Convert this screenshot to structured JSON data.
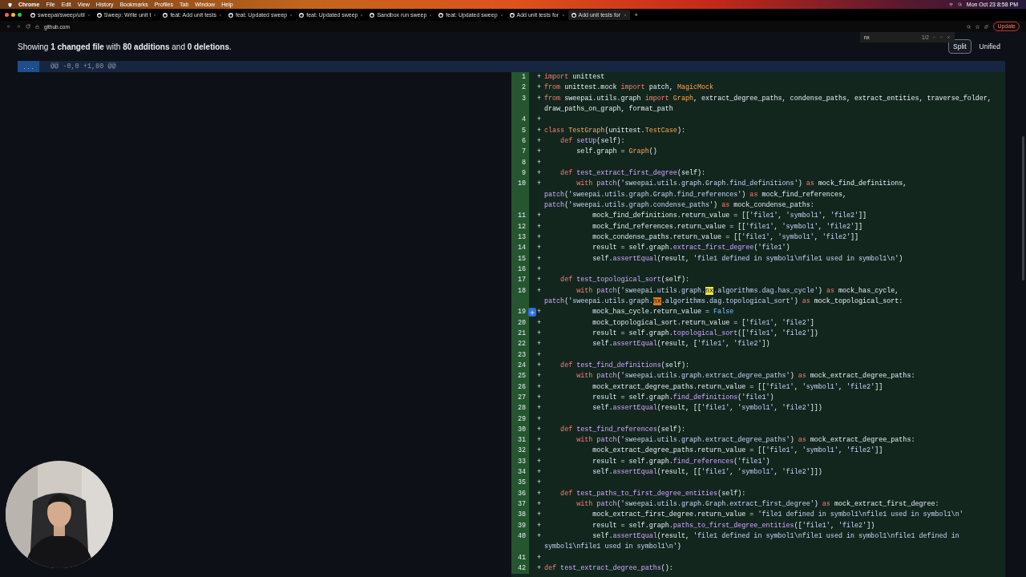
{
  "menu_bar": {
    "items": [
      "Chrome",
      "File",
      "Edit",
      "View",
      "History",
      "Bookmarks",
      "Profiles",
      "Tab",
      "Window",
      "Help"
    ],
    "clock": "Mon Oct 23  8:58 PM"
  },
  "tabs": [
    {
      "label": "sweepai/sweep/util",
      "selected": false
    },
    {
      "label": "Sweep: Write unit t",
      "selected": false
    },
    {
      "label": "feat: Add unit tests",
      "selected": false
    },
    {
      "label": "feat: Updated sweep",
      "selected": false
    },
    {
      "label": "feat: Updated sweep",
      "selected": false
    },
    {
      "label": "Sandbox run sweep",
      "selected": false
    },
    {
      "label": "feat: Updated sweep",
      "selected": false
    },
    {
      "label": "Add unit tests for",
      "selected": false
    },
    {
      "label": "Add unit tests for",
      "selected": true
    }
  ],
  "new_tab": "+",
  "address_bar": {
    "host": "github.com"
  },
  "update_button": "Update",
  "find_bar": {
    "query": "nx",
    "count": "1/2"
  },
  "summary": "Showing **1 changed file** with **80 additions** and **0 deletions**.",
  "view_toggle": [
    {
      "label": "Split",
      "selected": true
    },
    {
      "label": "Unified",
      "selected": false
    }
  ],
  "hunk": {
    "expand": "...",
    "header": "@@ -0,0 +1,80 @@"
  },
  "lines": [
    {
      "number": "1",
      "sign": "+",
      "tokens": [
        {
          "kind": "keyword",
          "text": "import"
        },
        {
          "kind": "plain",
          "text": " unittest"
        }
      ]
    },
    {
      "number": "2",
      "sign": "+",
      "tokens": [
        {
          "kind": "keyword",
          "text": "from"
        },
        {
          "kind": "plain",
          "text": " unittest.mock "
        },
        {
          "kind": "keyword",
          "text": "import"
        },
        {
          "kind": "plain",
          "text": " patch, "
        },
        {
          "kind": "class",
          "text": "MagicMock"
        }
      ]
    },
    {
      "number": "3",
      "sign": "+",
      "tokens": [
        {
          "kind": "keyword",
          "text": "from"
        },
        {
          "kind": "plain",
          "text": " sweepai.utils.graph "
        },
        {
          "kind": "keyword",
          "text": "import "
        },
        {
          "kind": "class",
          "text": "Graph"
        },
        {
          "kind": "plain",
          "text": ", extract_degree_paths, condense_paths, extract_entities, traverse_folder, draw_paths_on_graph, format_path"
        }
      ]
    },
    {
      "number": "4",
      "sign": "+"
    },
    {
      "number": "5",
      "sign": "+",
      "tokens": [
        {
          "kind": "keyword",
          "text": "class "
        },
        {
          "kind": "class",
          "text": "TestGraph"
        },
        {
          "kind": "plain",
          "text": "(unittest."
        },
        {
          "kind": "class",
          "text": "TestCase"
        },
        {
          "kind": "plain",
          "text": "):"
        }
      ]
    },
    {
      "number": "6",
      "sign": "+",
      "tokens": [
        {
          "kind": "keyword",
          "text": "    def "
        },
        {
          "kind": "function",
          "text": "setUp"
        },
        {
          "kind": "plain",
          "text": "(self):"
        }
      ]
    },
    {
      "number": "7",
      "sign": "+",
      "tokens": [
        {
          "kind": "plain",
          "text": "        self.graph = "
        },
        {
          "kind": "class",
          "text": "Graph"
        },
        {
          "kind": "plain",
          "text": "()"
        }
      ]
    },
    {
      "number": "8",
      "sign": "+"
    },
    {
      "number": "9",
      "sign": "+",
      "tokens": [
        {
          "kind": "keyword",
          "text": "    def "
        },
        {
          "kind": "function",
          "text": "test_extract_first_degree"
        },
        {
          "kind": "plain",
          "text": "(self):"
        }
      ]
    },
    {
      "number": "10",
      "sign": "+",
      "tokens": [
        {
          "kind": "keyword",
          "text": "        with "
        },
        {
          "kind": "function",
          "text": "patch"
        },
        {
          "kind": "plain",
          "text": "("
        },
        {
          "kind": "string",
          "text": "'sweepai.utils.graph.Graph.find_definitions'"
        },
        {
          "kind": "plain",
          "text": ") "
        },
        {
          "kind": "keyword",
          "text": "as"
        },
        {
          "kind": "plain",
          "text": " mock_find_definitions, "
        },
        {
          "kind": "function",
          "text": "patch"
        },
        {
          "kind": "plain",
          "text": "("
        },
        {
          "kind": "string",
          "text": "'sweepai.utils.graph.Graph.find_references'"
        },
        {
          "kind": "plain",
          "text": ") "
        },
        {
          "kind": "keyword",
          "text": "as"
        },
        {
          "kind": "plain",
          "text": " mock_find_references, "
        },
        {
          "kind": "function",
          "text": "patch"
        },
        {
          "kind": "plain",
          "text": "("
        },
        {
          "kind": "string",
          "text": "'sweepai.utils.graph.condense_paths'"
        },
        {
          "kind": "plain",
          "text": ") "
        },
        {
          "kind": "keyword",
          "text": "as"
        },
        {
          "kind": "plain",
          "text": " mock_condense_paths:"
        }
      ]
    },
    {
      "number": "11",
      "sign": "+",
      "tokens": [
        {
          "kind": "plain",
          "text": "            mock_find_definitions.return_value = [["
        },
        {
          "kind": "string",
          "text": "'file1'"
        },
        {
          "kind": "plain",
          "text": ", "
        },
        {
          "kind": "string",
          "text": "'symbol1'"
        },
        {
          "kind": "plain",
          "text": ", "
        },
        {
          "kind": "string",
          "text": "'file2'"
        },
        {
          "kind": "plain",
          "text": "]]"
        }
      ]
    },
    {
      "number": "12",
      "sign": "+",
      "tokens": [
        {
          "kind": "plain",
          "text": "            mock_find_references.return_value = [["
        },
        {
          "kind": "string",
          "text": "'file1'"
        },
        {
          "kind": "plain",
          "text": ", "
        },
        {
          "kind": "string",
          "text": "'symbol1'"
        },
        {
          "kind": "plain",
          "text": ", "
        },
        {
          "kind": "string",
          "text": "'file2'"
        },
        {
          "kind": "plain",
          "text": "]]"
        }
      ]
    },
    {
      "number": "13",
      "sign": "+",
      "tokens": [
        {
          "kind": "plain",
          "text": "            mock_condense_paths.return_value = [["
        },
        {
          "kind": "string",
          "text": "'file1'"
        },
        {
          "kind": "plain",
          "text": ", "
        },
        {
          "kind": "string",
          "text": "'symbol1'"
        },
        {
          "kind": "plain",
          "text": ", "
        },
        {
          "kind": "string",
          "text": "'file2'"
        },
        {
          "kind": "plain",
          "text": "]]"
        }
      ]
    },
    {
      "number": "14",
      "sign": "+",
      "tokens": [
        {
          "kind": "plain",
          "text": "            result = self.graph."
        },
        {
          "kind": "function",
          "text": "extract_first_degree"
        },
        {
          "kind": "plain",
          "text": "("
        },
        {
          "kind": "string",
          "text": "'file1'"
        },
        {
          "kind": "plain",
          "text": ")"
        }
      ]
    },
    {
      "number": "15",
      "sign": "+",
      "tokens": [
        {
          "kind": "plain",
          "text": "            self."
        },
        {
          "kind": "function",
          "text": "assertEqual"
        },
        {
          "kind": "plain",
          "text": "(result, "
        },
        {
          "kind": "string",
          "text": "'file1 defined in symbol1\\nfile1 used in symbol1\\n'"
        },
        {
          "kind": "plain",
          "text": ")"
        }
      ]
    },
    {
      "number": "16",
      "sign": "+"
    },
    {
      "number": "17",
      "sign": "+",
      "tokens": [
        {
          "kind": "keyword",
          "text": "    def "
        },
        {
          "kind": "function",
          "text": "test_topological_sort"
        },
        {
          "kind": "plain",
          "text": "(self):"
        }
      ]
    },
    {
      "number": "18",
      "sign": "+",
      "tokens": [
        {
          "kind": "keyword",
          "text": "        with "
        },
        {
          "kind": "function",
          "text": "patch"
        },
        {
          "kind": "plain",
          "text": "("
        },
        {
          "kind": "string",
          "text": "'sweepai.utils.graph."
        },
        {
          "kind": "match",
          "text": "nx"
        },
        {
          "kind": "string",
          "text": ".algorithms.dag.has_cycle'"
        },
        {
          "kind": "plain",
          "text": ") "
        },
        {
          "kind": "keyword",
          "text": "as"
        },
        {
          "kind": "plain",
          "text": " mock_has_cycle, "
        },
        {
          "kind": "function",
          "text": "patch"
        },
        {
          "kind": "plain",
          "text": "("
        },
        {
          "kind": "string",
          "text": "'sweepai.utils.graph."
        },
        {
          "kind": "current",
          "text": "nx"
        },
        {
          "kind": "string",
          "text": ".algorithms.dag.topological_sort'"
        },
        {
          "kind": "plain",
          "text": ") "
        },
        {
          "kind": "keyword",
          "text": "as"
        },
        {
          "kind": "plain",
          "text": " mock_topological_sort:"
        }
      ]
    },
    {
      "number": "19",
      "sign": "+",
      "comment_button": true,
      "tokens": [
        {
          "kind": "plain",
          "text": "            mock_has_cycle.return_value = "
        },
        {
          "kind": "constant",
          "text": "False"
        }
      ]
    },
    {
      "number": "20",
      "sign": "+",
      "tokens": [
        {
          "kind": "plain",
          "text": "            mock_topological_sort.return_value = ["
        },
        {
          "kind": "string",
          "text": "'file1'"
        },
        {
          "kind": "plain",
          "text": ", "
        },
        {
          "kind": "string",
          "text": "'file2'"
        },
        {
          "kind": "plain",
          "text": "]"
        }
      ]
    },
    {
      "number": "21",
      "sign": "+",
      "tokens": [
        {
          "kind": "plain",
          "text": "            result = self.graph."
        },
        {
          "kind": "function",
          "text": "topological_sort"
        },
        {
          "kind": "plain",
          "text": "(["
        },
        {
          "kind": "string",
          "text": "'file1'"
        },
        {
          "kind": "plain",
          "text": ", "
        },
        {
          "kind": "string",
          "text": "'file2'"
        },
        {
          "kind": "plain",
          "text": "])"
        }
      ]
    },
    {
      "number": "22",
      "sign": "+",
      "tokens": [
        {
          "kind": "plain",
          "text": "            self."
        },
        {
          "kind": "function",
          "text": "assertEqual"
        },
        {
          "kind": "plain",
          "text": "(result, ["
        },
        {
          "kind": "string",
          "text": "'file1'"
        },
        {
          "kind": "plain",
          "text": ", "
        },
        {
          "kind": "string",
          "text": "'file2'"
        },
        {
          "kind": "plain",
          "text": "])"
        }
      ]
    },
    {
      "number": "23",
      "sign": "+"
    },
    {
      "number": "24",
      "sign": "+",
      "tokens": [
        {
          "kind": "keyword",
          "text": "    def "
        },
        {
          "kind": "function",
          "text": "test_find_definitions"
        },
        {
          "kind": "plain",
          "text": "(self):"
        }
      ]
    },
    {
      "number": "25",
      "sign": "+",
      "tokens": [
        {
          "kind": "keyword",
          "text": "        with "
        },
        {
          "kind": "function",
          "text": "patch"
        },
        {
          "kind": "plain",
          "text": "("
        },
        {
          "kind": "string",
          "text": "'sweepai.utils.graph.extract_degree_paths'"
        },
        {
          "kind": "plain",
          "text": ") "
        },
        {
          "kind": "keyword",
          "text": "as"
        },
        {
          "kind": "plain",
          "text": " mock_extract_degree_paths:"
        }
      ]
    },
    {
      "number": "26",
      "sign": "+",
      "tokens": [
        {
          "kind": "plain",
          "text": "            mock_extract_degree_paths.return_value = [["
        },
        {
          "kind": "string",
          "text": "'file1'"
        },
        {
          "kind": "plain",
          "text": ", "
        },
        {
          "kind": "string",
          "text": "'symbol1'"
        },
        {
          "kind": "plain",
          "text": ", "
        },
        {
          "kind": "string",
          "text": "'file2'"
        },
        {
          "kind": "plain",
          "text": "]]"
        }
      ]
    },
    {
      "number": "27",
      "sign": "+",
      "tokens": [
        {
          "kind": "plain",
          "text": "            result = self.graph."
        },
        {
          "kind": "function",
          "text": "find_definitions"
        },
        {
          "kind": "plain",
          "text": "("
        },
        {
          "kind": "string",
          "text": "'file1'"
        },
        {
          "kind": "plain",
          "text": ")"
        }
      ]
    },
    {
      "number": "28",
      "sign": "+",
      "tokens": [
        {
          "kind": "plain",
          "text": "            self."
        },
        {
          "kind": "function",
          "text": "assertEqual"
        },
        {
          "kind": "plain",
          "text": "(result, [["
        },
        {
          "kind": "string",
          "text": "'file1'"
        },
        {
          "kind": "plain",
          "text": ", "
        },
        {
          "kind": "string",
          "text": "'symbol1'"
        },
        {
          "kind": "plain",
          "text": ", "
        },
        {
          "kind": "string",
          "text": "'file2'"
        },
        {
          "kind": "plain",
          "text": "]])"
        }
      ]
    },
    {
      "number": "29",
      "sign": "+"
    },
    {
      "number": "30",
      "sign": "+",
      "tokens": [
        {
          "kind": "keyword",
          "text": "    def "
        },
        {
          "kind": "function",
          "text": "test_find_references"
        },
        {
          "kind": "plain",
          "text": "(self):"
        }
      ]
    },
    {
      "number": "31",
      "sign": "+",
      "tokens": [
        {
          "kind": "keyword",
          "text": "        with "
        },
        {
          "kind": "function",
          "text": "patch"
        },
        {
          "kind": "plain",
          "text": "("
        },
        {
          "kind": "string",
          "text": "'sweepai.utils.graph.extract_degree_paths'"
        },
        {
          "kind": "plain",
          "text": ") "
        },
        {
          "kind": "keyword",
          "text": "as"
        },
        {
          "kind": "plain",
          "text": " mock_extract_degree_paths:"
        }
      ]
    },
    {
      "number": "32",
      "sign": "+",
      "tokens": [
        {
          "kind": "plain",
          "text": "            mock_extract_degree_paths.return_value = [["
        },
        {
          "kind": "string",
          "text": "'file1'"
        },
        {
          "kind": "plain",
          "text": ", "
        },
        {
          "kind": "string",
          "text": "'symbol1'"
        },
        {
          "kind": "plain",
          "text": ", "
        },
        {
          "kind": "string",
          "text": "'file2'"
        },
        {
          "kind": "plain",
          "text": "]]"
        }
      ]
    },
    {
      "number": "33",
      "sign": "+",
      "tokens": [
        {
          "kind": "plain",
          "text": "            result = self.graph."
        },
        {
          "kind": "function",
          "text": "find_references"
        },
        {
          "kind": "plain",
          "text": "("
        },
        {
          "kind": "string",
          "text": "'file1'"
        },
        {
          "kind": "plain",
          "text": ")"
        }
      ]
    },
    {
      "number": "34",
      "sign": "+",
      "tokens": [
        {
          "kind": "plain",
          "text": "            self."
        },
        {
          "kind": "function",
          "text": "assertEqual"
        },
        {
          "kind": "plain",
          "text": "(result, [["
        },
        {
          "kind": "string",
          "text": "'file1'"
        },
        {
          "kind": "plain",
          "text": ", "
        },
        {
          "kind": "string",
          "text": "'symbol1'"
        },
        {
          "kind": "plain",
          "text": ", "
        },
        {
          "kind": "string",
          "text": "'file2'"
        },
        {
          "kind": "plain",
          "text": "]])"
        }
      ]
    },
    {
      "number": "35",
      "sign": "+"
    },
    {
      "number": "36",
      "sign": "+",
      "tokens": [
        {
          "kind": "keyword",
          "text": "    def "
        },
        {
          "kind": "function",
          "text": "test_paths_to_first_degree_entities"
        },
        {
          "kind": "plain",
          "text": "(self):"
        }
      ]
    },
    {
      "number": "37",
      "sign": "+",
      "tokens": [
        {
          "kind": "keyword",
          "text": "        with "
        },
        {
          "kind": "function",
          "text": "patch"
        },
        {
          "kind": "plain",
          "text": "("
        },
        {
          "kind": "string",
          "text": "'sweepai.utils.graph.Graph.extract_first_degree'"
        },
        {
          "kind": "plain",
          "text": ") "
        },
        {
          "kind": "keyword",
          "text": "as"
        },
        {
          "kind": "plain",
          "text": " mock_extract_first_degree:"
        }
      ]
    },
    {
      "number": "38",
      "sign": "+",
      "tokens": [
        {
          "kind": "plain",
          "text": "            mock_extract_first_degree.return_value = "
        },
        {
          "kind": "string",
          "text": "'file1 defined in symbol1\\nfile1 used in symbol1\\n'"
        }
      ]
    },
    {
      "number": "39",
      "sign": "+",
      "tokens": [
        {
          "kind": "plain",
          "text": "            result = self.graph."
        },
        {
          "kind": "function",
          "text": "paths_to_first_degree_entities"
        },
        {
          "kind": "plain",
          "text": "(["
        },
        {
          "kind": "string",
          "text": "'file1'"
        },
        {
          "kind": "plain",
          "text": ", "
        },
        {
          "kind": "string",
          "text": "'file2'"
        },
        {
          "kind": "plain",
          "text": "])"
        }
      ]
    },
    {
      "number": "40",
      "sign": "+",
      "tokens": [
        {
          "kind": "plain",
          "text": "            self."
        },
        {
          "kind": "function",
          "text": "assertEqual"
        },
        {
          "kind": "plain",
          "text": "(result, "
        },
        {
          "kind": "string",
          "text": "'file1 defined in symbol1\\nfile1 used in symbol1\\nfile1 defined in symbol1\\nfile1 used in symbol1\\n'"
        },
        {
          "kind": "plain",
          "text": ")"
        }
      ]
    },
    {
      "number": "41",
      "sign": "+"
    },
    {
      "number": "42",
      "sign": "+",
      "tokens": [
        {
          "kind": "keyword",
          "text": "def "
        },
        {
          "kind": "function",
          "text": "test_extract_degree_paths"
        },
        {
          "kind": "plain",
          "text": "():"
        }
      ]
    }
  ]
}
